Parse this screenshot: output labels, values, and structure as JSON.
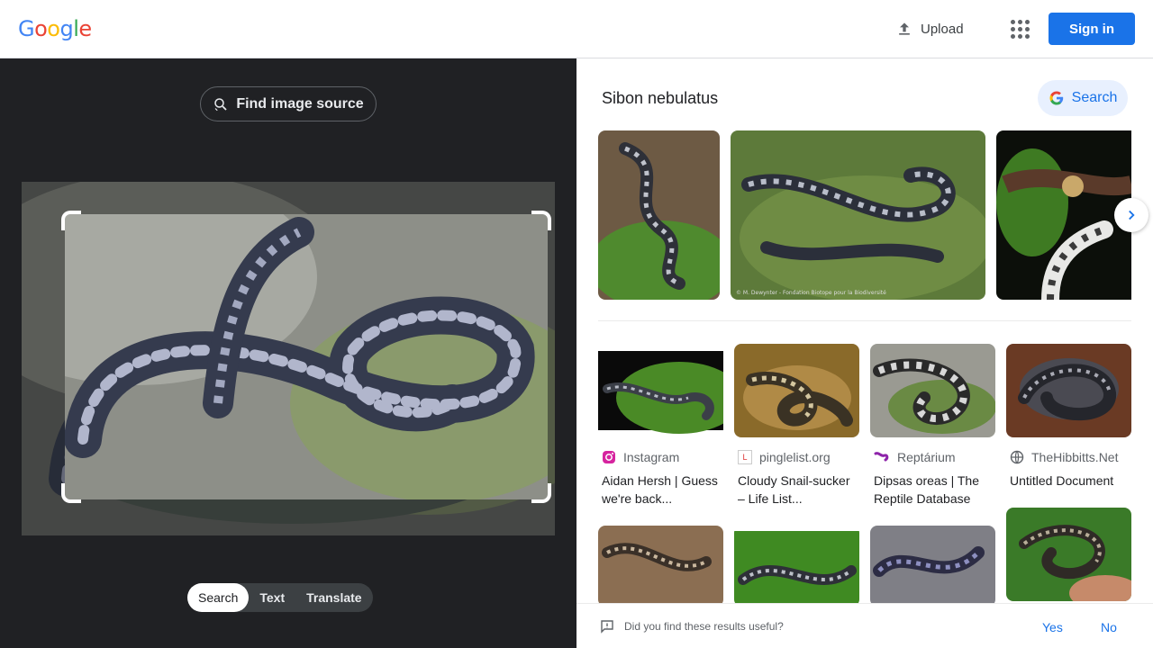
{
  "header": {
    "logo_text": "Google",
    "upload_label": "Upload",
    "signin_label": "Sign in",
    "accent_color": "#1a73e8"
  },
  "query_panel": {
    "find_source_label": "Find image source",
    "modes": [
      {
        "label": "Search",
        "active": true
      },
      {
        "label": "Text",
        "active": false
      },
      {
        "label": "Translate",
        "active": false
      }
    ]
  },
  "results": {
    "entity_title": "Sibon nebulatus",
    "search_button_label": "Search",
    "strip_caption": "© M. Dewynter - Fondation Biotope pour la Biodiversité",
    "cards": [
      {
        "source": "Instagram",
        "title": "Aidan Hersh | Guess we're back..."
      },
      {
        "source": "pinglelist.org",
        "title": "Cloudy Snail-sucker – Life List..."
      },
      {
        "source": "Reptárium",
        "title": "Dipsas oreas | The Reptile Database"
      },
      {
        "source": "TheHibbitts.Net",
        "title": "Untitled Document"
      }
    ],
    "feedback": {
      "question": "Did you find these results useful?",
      "yes_label": "Yes",
      "no_label": "No"
    }
  }
}
